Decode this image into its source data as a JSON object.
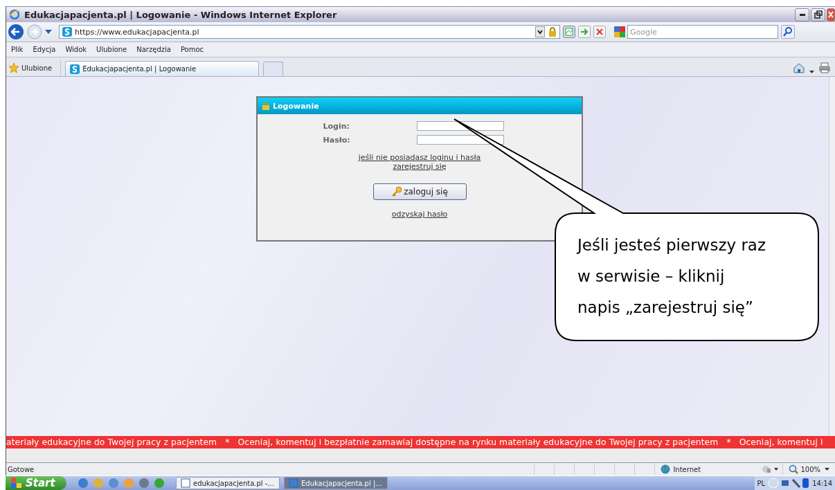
{
  "window": {
    "title": "Edukacjapacjenta.pl | Logowanie - Windows Internet Explorer"
  },
  "address_bar": {
    "url": "https://www.edukacjapacjenta.pl"
  },
  "search": {
    "placeholder": "Google"
  },
  "menu": [
    "Plik",
    "Edycja",
    "Widok",
    "Ulubione",
    "Narzędzia",
    "Pomoc"
  ],
  "favorites": {
    "label": "Ulubione"
  },
  "tabs": [
    {
      "label": "Edukacjapacjenta.pl | Logowanie",
      "selected": true
    }
  ],
  "login_panel": {
    "title": "Logowanie",
    "fields": [
      {
        "label": "Login:"
      },
      {
        "label": "Hasło:"
      }
    ],
    "register_link": [
      "jeśli nie posiadasz loginu i hasła",
      "zarejestruj się"
    ],
    "button": "zaloguj się",
    "recover_link": "odzyskaj hasło"
  },
  "callout": {
    "lines": [
      "Jeśli jesteś pierwszy raz",
      "w serwisie – kliknij",
      "napis „zarejestruj się”"
    ]
  },
  "ticker": "ateriały edukacyjne do Twojej pracy z pacjentem   *   Oceniaj, komentuj i bezpłatnie zamawiaj dostępne na rynku materiały edukacyjne do Twojej pracy z pacjentem   *   Oceniaj, komentuj i",
  "status_bar": {
    "status": "Gotowe",
    "zone": "Internet",
    "zoom": "100%"
  },
  "taskbar": {
    "start": "Start",
    "tasks": [
      {
        "label": "edukacjapacjenta.pl -...",
        "selected": false
      },
      {
        "label": "Edukacjapacjenta.pl |...",
        "selected": true
      }
    ],
    "language": "PL",
    "clock": "14:14"
  }
}
